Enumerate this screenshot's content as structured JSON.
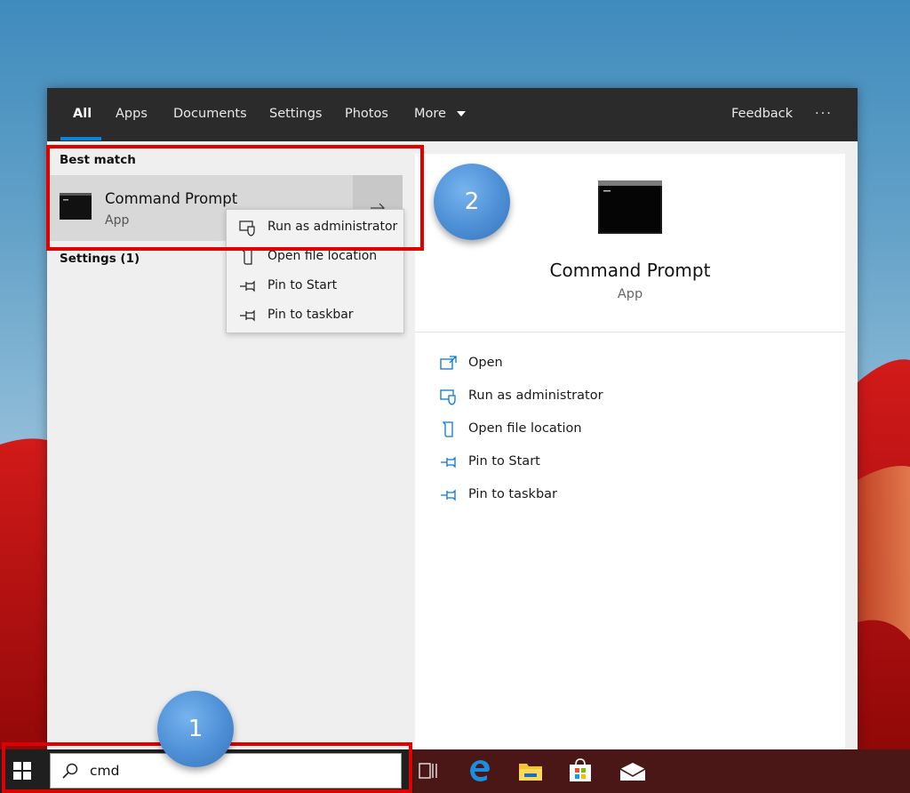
{
  "tabs": [
    {
      "label": "All",
      "active": true
    },
    {
      "label": "Apps"
    },
    {
      "label": "Documents"
    },
    {
      "label": "Settings"
    },
    {
      "label": "Photos"
    },
    {
      "label": "More"
    }
  ],
  "feedback_label": "Feedback",
  "overflow_label": "···",
  "left": {
    "best_match_title": "Best match",
    "result": {
      "title": "Command Prompt",
      "subtitle": "App"
    },
    "settings_title": "Settings (1)"
  },
  "context_menu": [
    {
      "label": "Run as administrator",
      "icon": "shield-icon"
    },
    {
      "label": "Open file location",
      "icon": "folder-icon"
    },
    {
      "label": "Pin to Start",
      "icon": "pin-icon"
    },
    {
      "label": "Pin to taskbar",
      "icon": "pin-icon"
    }
  ],
  "right": {
    "app_title": "Command Prompt",
    "app_subtitle": "App",
    "actions": [
      {
        "label": "Open",
        "icon": "open-icon"
      },
      {
        "label": "Run as administrator",
        "icon": "shield-icon"
      },
      {
        "label": "Open file location",
        "icon": "folder-icon"
      },
      {
        "label": "Pin to Start",
        "icon": "pin-icon"
      },
      {
        "label": "Pin to taskbar",
        "icon": "pin-icon"
      }
    ]
  },
  "search": {
    "value": "cmd"
  },
  "annotations": {
    "step1": "1",
    "step2": "2"
  },
  "colors": {
    "accent": "#0a84d8",
    "highlight": "#e00000",
    "topbar": "#2b2b2b"
  }
}
